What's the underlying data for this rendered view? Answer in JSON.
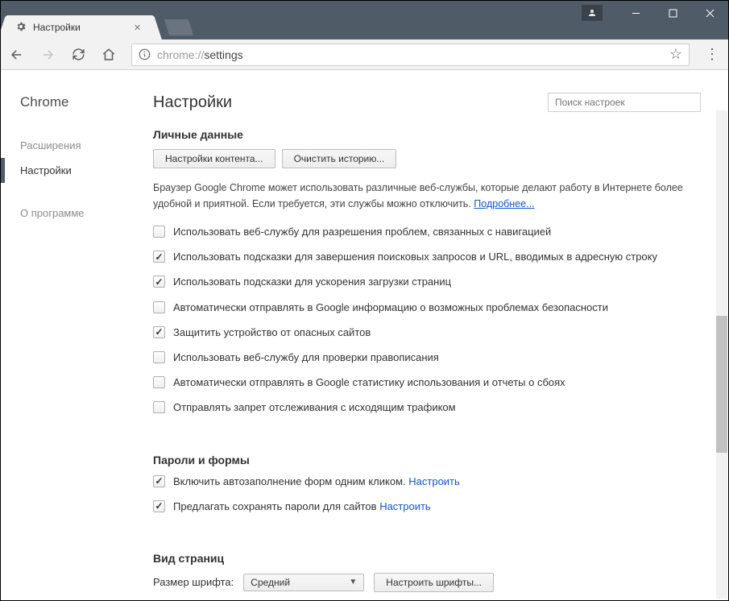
{
  "tab": {
    "title": "Настройки"
  },
  "url": {
    "proto": "chrome://",
    "path": "settings"
  },
  "sidebar": {
    "brand": "Chrome",
    "items": [
      {
        "label": "Расширения",
        "active": false
      },
      {
        "label": "Настройки",
        "active": true
      },
      {
        "label": "О программе",
        "active": false
      }
    ]
  },
  "header": {
    "title": "Настройки",
    "search_placeholder": "Поиск настроек"
  },
  "privacy": {
    "title": "Личные данные",
    "content_btn": "Настройки контента...",
    "clear_btn": "Очистить историю...",
    "desc": "Браузер Google Chrome может использовать различные веб-службы, которые делают работу в Интернете более удобной и приятной. Если требуется, эти службы можно отключить. ",
    "more_link": "Подробнее...",
    "options": [
      {
        "checked": false,
        "label": "Использовать веб-службу для разрешения проблем, связанных с навигацией"
      },
      {
        "checked": true,
        "label": "Использовать подсказки для завершения поисковых запросов и URL, вводимых в адресную строку"
      },
      {
        "checked": true,
        "label": "Использовать подсказки для ускорения загрузки страниц"
      },
      {
        "checked": false,
        "label": "Автоматически отправлять в Google информацию о возможных проблемах безопасности"
      },
      {
        "checked": true,
        "label": "Защитить устройство от опасных сайтов"
      },
      {
        "checked": false,
        "label": "Использовать веб-службу для проверки правописания"
      },
      {
        "checked": false,
        "label": "Автоматически отправлять в Google статистику использования и отчеты о сбоях"
      },
      {
        "checked": false,
        "label": "Отправлять запрет отслеживания с исходящим трафиком"
      }
    ]
  },
  "passwords": {
    "title": "Пароли и формы",
    "options": [
      {
        "checked": true,
        "label": "Включить автозаполнение форм одним кликом. ",
        "link": "Настроить"
      },
      {
        "checked": true,
        "label": "Предлагать сохранять пароли для сайтов ",
        "link": "Настроить"
      }
    ]
  },
  "appearance": {
    "title": "Вид страниц",
    "font_size_label": "Размер шрифта:",
    "font_size_value": "Средний",
    "fonts_btn": "Настроить шрифты..."
  }
}
